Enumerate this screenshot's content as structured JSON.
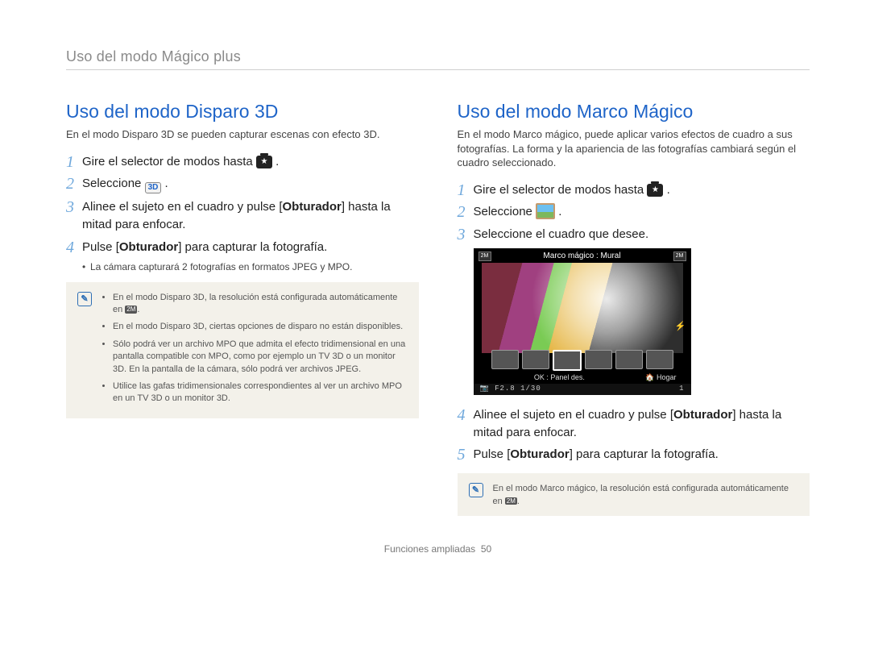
{
  "header": "Uso del modo Mágico plus",
  "left": {
    "title": "Uso del modo Disparo 3D",
    "lead": "En el modo Disparo 3D se pueden capturar escenas con efecto 3D.",
    "step1_pre": "Gire el selector de modos hasta ",
    "step1_post": " .",
    "step2_pre": "Seleccione ",
    "icon3d": "3D",
    "step2_post": " .",
    "step3_a": "Alinee el sujeto en el cuadro y pulse [",
    "obturador": "Obturador",
    "step3_b": "] hasta la mitad para enfocar.",
    "step4_a": "Pulse [",
    "step4_b": "] para capturar la fotografía.",
    "substep": "La cámara capturará 2 fotografías en formatos JPEG y MPO.",
    "note": {
      "badge": "2M",
      "items": [
        "En el modo Disparo 3D, la resolución está configurada automáticamente en {badge}.",
        "En el modo Disparo 3D, ciertas opciones de disparo no están disponibles.",
        "Sólo podrá ver un archivo MPO que admita el efecto tridimensional en una pantalla compatible con MPO, como por ejemplo un TV 3D o un monitor 3D. En la pantalla de la cámara, sólo podrá ver archivos JPEG.",
        "Utilice las gafas tridimensionales correspondientes al ver un archivo MPO en un TV 3D o un monitor 3D."
      ]
    }
  },
  "right": {
    "title": "Uso del modo Marco Mágico",
    "lead": "En el modo Marco mágico, puede aplicar varios efectos de cuadro a sus fotografías. La forma y la apariencia de las fotografías cambiará según el cuadro seleccionado.",
    "step1_pre": "Gire el selector de modos hasta ",
    "step1_post": " .",
    "step2_pre": "Seleccione ",
    "step2_post": " .",
    "step3": "Seleccione el cuadro que desee.",
    "preview": {
      "title": "Marco mágico : Mural",
      "ok": "OK : Panel des.",
      "home": "Hogar",
      "exposure": "F2.8  1/30",
      "right_info": "1",
      "corner": "2M"
    },
    "step4_a": "Alinee el sujeto en el cuadro y pulse [",
    "obturador": "Obturador",
    "step4_b": "] hasta la mitad para enfocar.",
    "step5_a": "Pulse [",
    "step5_b": "] para capturar la fotografía.",
    "note": {
      "text_a": "En el modo Marco mágico, la resolución está configurada automáticamente en ",
      "badge": "2M",
      "text_b": "."
    }
  },
  "footer": {
    "section": "Funciones ampliadas",
    "page": "50"
  }
}
